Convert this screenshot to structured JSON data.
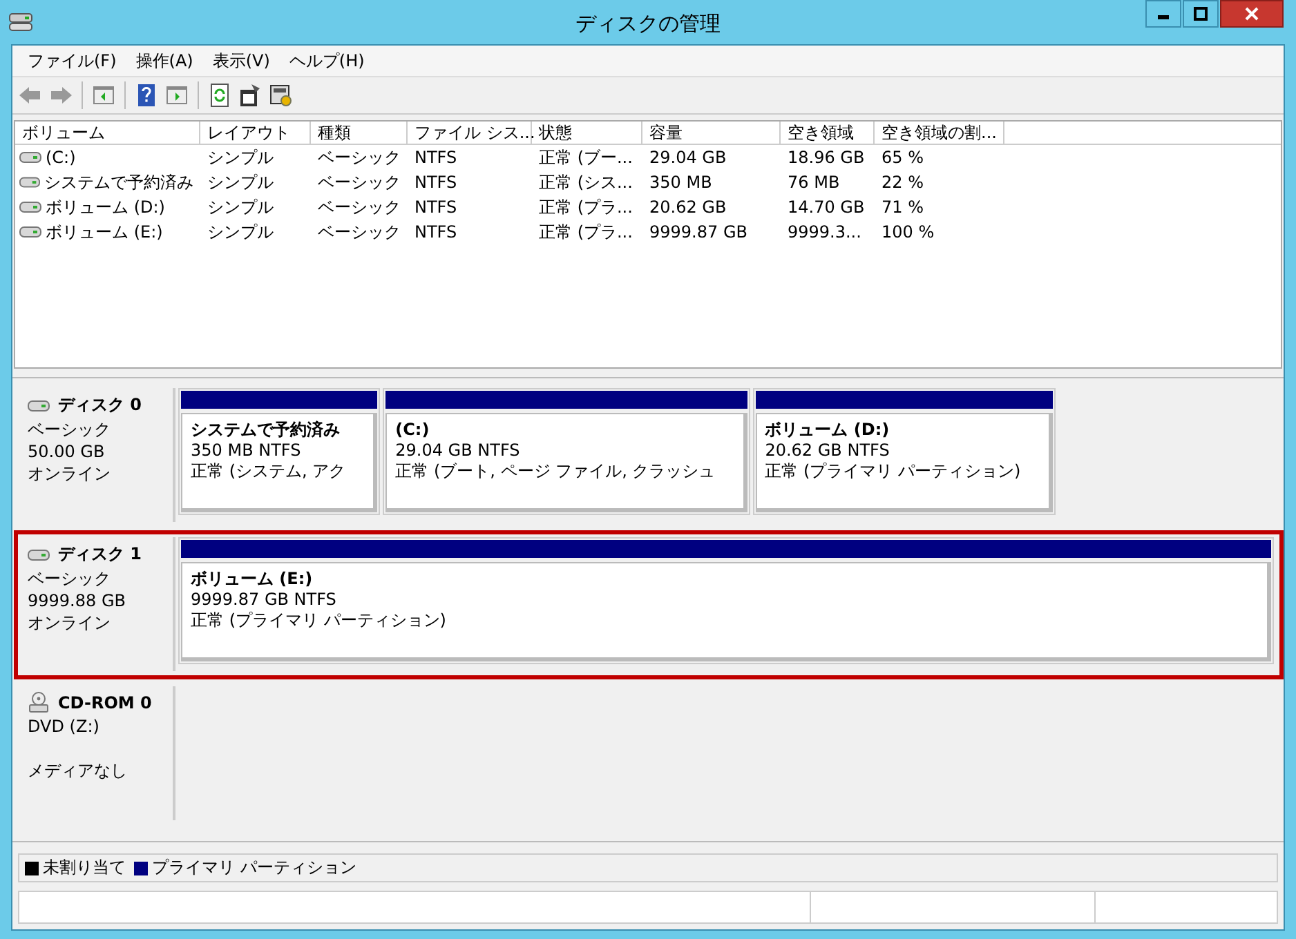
{
  "window": {
    "title": "ディスクの管理"
  },
  "menu": [
    "ファイル(F)",
    "操作(A)",
    "表示(V)",
    "ヘルプ(H)"
  ],
  "volume_table": {
    "columns": [
      "ボリューム",
      "レイアウト",
      "種類",
      "ファイル シス...",
      "状態",
      "容量",
      "空き領域",
      "空き領域の割..."
    ],
    "rows": [
      [
        "(C:)",
        "シンプル",
        "ベーシック",
        "NTFS",
        "正常 (ブー...",
        "29.04 GB",
        "18.96 GB",
        "65 %"
      ],
      [
        "システムで予約済み",
        "シンプル",
        "ベーシック",
        "NTFS",
        "正常 (シス...",
        "350 MB",
        "76 MB",
        "22 %"
      ],
      [
        "ボリューム (D:)",
        "シンプル",
        "ベーシック",
        "NTFS",
        "正常 (プラ...",
        "20.62 GB",
        "14.70 GB",
        "71 %"
      ],
      [
        "ボリューム (E:)",
        "シンプル",
        "ベーシック",
        "NTFS",
        "正常 (プラ...",
        "9999.87 GB",
        "9999.3...",
        "100 %"
      ]
    ]
  },
  "disks": [
    {
      "kind": "disk",
      "name": "ディスク 0",
      "type": "ベーシック",
      "size": "50.00 GB",
      "status": "オンライン",
      "highlighted": false,
      "partitions": [
        {
          "name": "システムで予約済み",
          "size": "350 MB NTFS",
          "status": "正常 (システム, アク",
          "fill": false
        },
        {
          "name": "(C:)",
          "size": "29.04 GB NTFS",
          "status": "正常 (ブート, ページ ファイル, クラッシュ",
          "fill": false
        },
        {
          "name": "ボリューム (D:)",
          "size": "20.62 GB NTFS",
          "status": "正常 (プライマリ パーティション)",
          "fill": false
        }
      ]
    },
    {
      "kind": "disk",
      "name": "ディスク 1",
      "type": "ベーシック",
      "size": "9999.88 GB",
      "status": "オンライン",
      "highlighted": true,
      "partitions": [
        {
          "name": "ボリューム (E:)",
          "size": "9999.87 GB NTFS",
          "status": "正常 (プライマリ パーティション)",
          "fill": true
        }
      ]
    },
    {
      "kind": "cdrom",
      "name": "CD-ROM 0",
      "type": "DVD (Z:)",
      "status": "メディアなし",
      "highlighted": false
    }
  ],
  "legend": [
    {
      "label": "未割り当て",
      "color": "#000000"
    },
    {
      "label": "プライマリ パーティション",
      "color": "#000080"
    }
  ]
}
